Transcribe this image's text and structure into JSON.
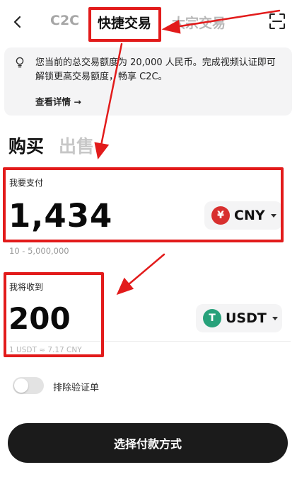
{
  "header": {
    "tabs": [
      {
        "label": "C2C"
      },
      {
        "label": "快捷交易"
      },
      {
        "label": "大宗交易"
      }
    ]
  },
  "notice": {
    "text": "您当前的总交易额度为 20,000 人民币。完成视频认证即可解锁更高交易额度，畅享 C2C。",
    "link": "查看详情 →"
  },
  "mode": {
    "buy": "购买",
    "sell": "出售"
  },
  "pay": {
    "label": "我要支付",
    "amount": "1,434",
    "currency": "CNY",
    "currency_symbol": "¥",
    "range": "10 - 5,000,000"
  },
  "receive": {
    "label": "我将收到",
    "amount": "200",
    "currency": "USDT",
    "currency_symbol": "T",
    "rate": "1 USDT ≈ 7.17 CNY"
  },
  "option": {
    "label": "排除验证单"
  },
  "cta": {
    "label": "选择付款方式"
  },
  "colors": {
    "annotation": "#e21b1b",
    "cny": "#d8302f",
    "usdt": "#27a17a",
    "button": "#1b1b1b"
  }
}
